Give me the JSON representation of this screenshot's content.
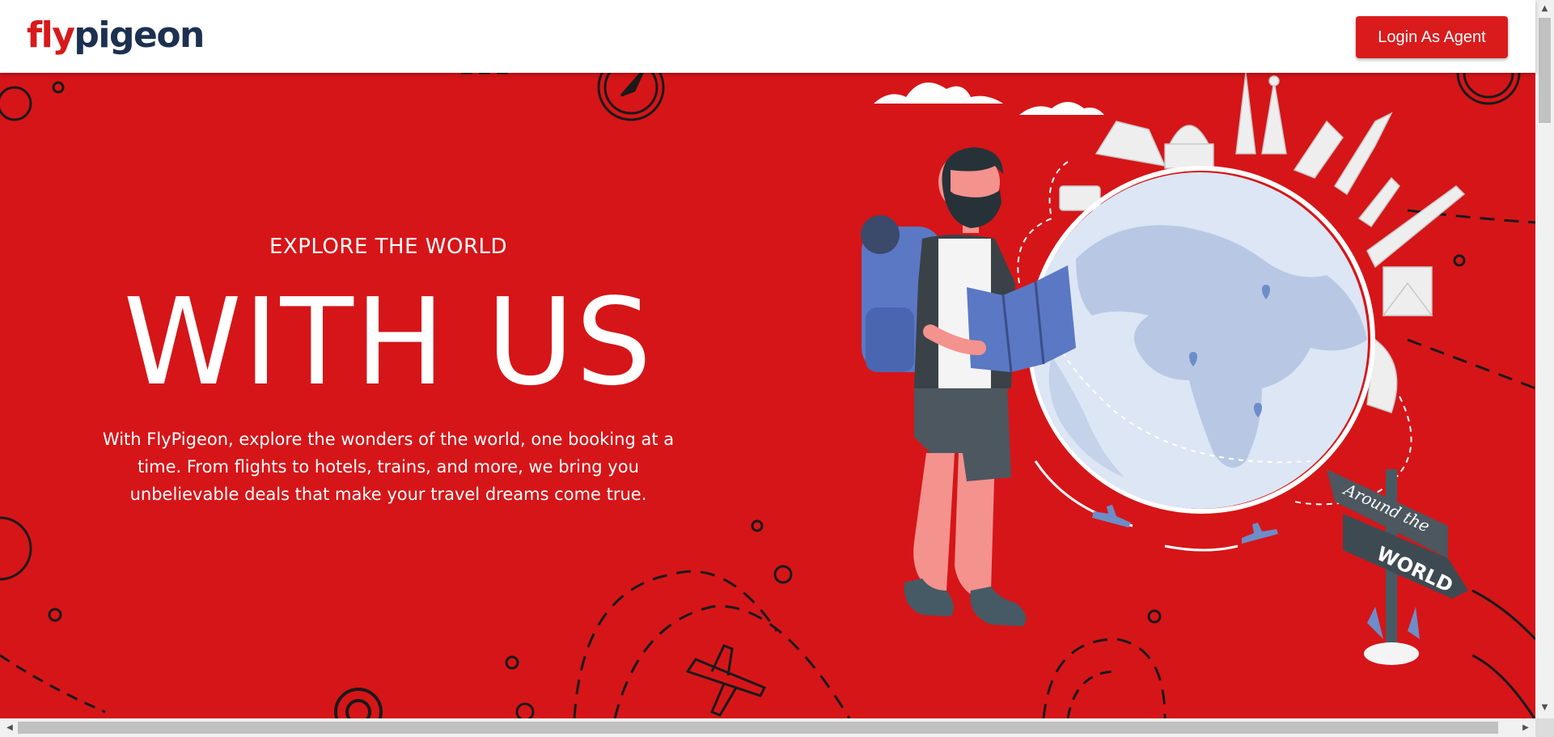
{
  "header": {
    "logo": {
      "part1": "fly",
      "part2": "pigeon"
    },
    "login_button": "Login As Agent"
  },
  "hero": {
    "eyebrow": "EXPLORE THE WORLD",
    "headline": "WITH US",
    "description": "With FlyPigeon, explore the wonders of the world, one booking at a time. From flights to hotels, trains, and more, we bring you unbelievable deals that make your travel dreams come true.",
    "signpost_top": "Around the",
    "signpost_bottom": "WORLD"
  },
  "colors": {
    "brand_red": "#d61518",
    "brand_navy": "#1c3050",
    "button_red": "#da1b1b"
  },
  "icons": [
    "compass-icon",
    "airplane-icon",
    "location-pin-icon",
    "globe-icon",
    "signpost-icon"
  ]
}
